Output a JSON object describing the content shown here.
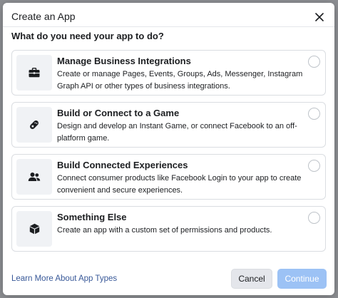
{
  "dialog": {
    "title": "Create an App",
    "question": "What do you need your app to do?"
  },
  "options": [
    {
      "title": "Manage Business Integrations",
      "description": "Create or manage Pages, Events, Groups, Ads, Messenger, Instagram Graph API or other types of business integrations.",
      "icon": "briefcase-icon",
      "selected": false
    },
    {
      "title": "Build or Connect to a Game",
      "description": "Design and develop an Instant Game, or connect Facebook to an off-platform game.",
      "icon": "game-controller-icon",
      "selected": false
    },
    {
      "title": "Build Connected Experiences",
      "description": "Connect consumer products like Facebook Login to your app to create convenient and secure experiences.",
      "icon": "people-icon",
      "selected": false
    },
    {
      "title": "Something Else",
      "description": "Create an app with a custom set of permissions and products.",
      "icon": "cube-icon",
      "selected": false
    }
  ],
  "footer": {
    "learn_more": "Learn More About App Types",
    "cancel_label": "Cancel",
    "continue_label": "Continue"
  },
  "colors": {
    "link": "#385898",
    "continue_disabled": "#9cc2f5",
    "backdrop": "#8d8f93"
  }
}
